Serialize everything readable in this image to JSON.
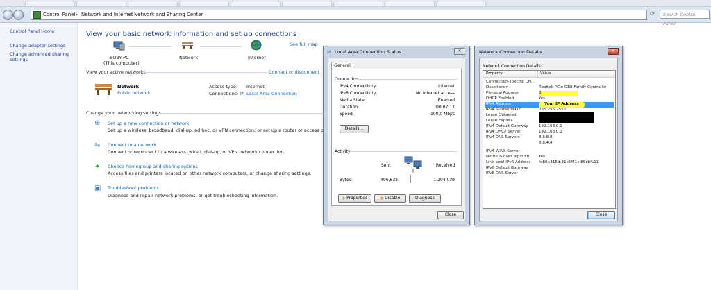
{
  "address_bar": {
    "crumbs": [
      "Control Panel",
      "Network and Internet",
      "Network and Sharing Center"
    ],
    "search_placeholder": "Search Control Panel"
  },
  "left_pane": {
    "items": [
      "Control Panel Home",
      "Change adapter settings",
      "Change advanced sharing",
      "settings"
    ]
  },
  "main": {
    "title": "View your basic network information and set up connections",
    "see_full_map": "See full map",
    "map": {
      "computer": "BOBY-PC",
      "computer_sub": "(This computer)",
      "network": "Network",
      "internet": "Internet"
    },
    "active_networks_heading": "View your active networks",
    "connect_disconnect": "Connect or disconnect",
    "network_name": "Network",
    "network_type": "Public network",
    "access_type_label": "Access type:",
    "access_type_value": "Internet",
    "connections_label": "Connections:",
    "connections_value": "Local Area Connection",
    "change_settings_heading": "Change your networking settings",
    "tasks": [
      {
        "title": "Set up a new connection or network",
        "desc": "Set up a wireless, broadband, dial-up, ad hoc, or VPN connection; or set up a router or access point."
      },
      {
        "title": "Connect to a network",
        "desc": "Connect or reconnect to a wireless, wired, dial-up, or VPN network connection."
      },
      {
        "title": "Choose homegroup and sharing options",
        "desc": "Access files and printers located on other network computers, or change sharing settings."
      },
      {
        "title": "Troubleshoot problems",
        "desc": "Diagnose and repair network problems, or get troubleshooting information."
      }
    ]
  },
  "status_dialog": {
    "title": "Local Area Connection Status",
    "close_glyph": "✕",
    "tab": "General",
    "connection_heading": "Connection",
    "fields": [
      {
        "label": "IPv4 Connectivity:",
        "value": "Internet"
      },
      {
        "label": "IPv6 Connectivity:",
        "value": "No Internet access"
      },
      {
        "label": "Media State:",
        "value": "Enabled"
      },
      {
        "label": "Duration:",
        "value": "00:02:17"
      },
      {
        "label": "Speed:",
        "value": "100.0 Mbps"
      }
    ],
    "details_button": "Details...",
    "activity_heading": "Activity",
    "sent_label": "Sent",
    "received_label": "Received",
    "bytes_label": "Bytes:",
    "bytes_sent": "406,632",
    "bytes_received": "1,294,039",
    "properties_button": "Properties",
    "disable_button": "Disable",
    "diagnose_button": "Diagnose",
    "close_button": "Close"
  },
  "details_dialog": {
    "title": "Network Connection Details",
    "close_glyph": "✕",
    "heading": "Network Connection Details:",
    "col_property": "Property",
    "col_value": "Value",
    "rows": [
      {
        "p": "Connection-specific DN...",
        "v": ""
      },
      {
        "p": "Description",
        "v": "Realtek PCIe GBE Family Controller"
      },
      {
        "p": "Physical Address",
        "v": "3"
      },
      {
        "p": "DHCP Enabled",
        "v": "Yes"
      },
      {
        "p": "IPv4 Address",
        "v": "Your IP Address"
      },
      {
        "p": "IPv4 Subnet Mask",
        "v": "255.255.255.0"
      },
      {
        "p": "Lease Obtained",
        "v": ""
      },
      {
        "p": "Lease Expires",
        "v": ""
      },
      {
        "p": "IPv4 Default Gateway",
        "v": "192.168.0.1"
      },
      {
        "p": "IPv4 DHCP Server",
        "v": "192.168.0.1"
      },
      {
        "p": "IPv4 DNS Servers",
        "v": "8.8.8.8"
      },
      {
        "p": "",
        "v": "8.8.4.4"
      },
      {
        "p": "IPv4 WINS Server",
        "v": ""
      },
      {
        "p": "NetBIOS over Tcpip En...",
        "v": "Yes"
      },
      {
        "p": "Link-local IPv6 Address",
        "v": "fe80::315d:31c5f51c:86cb%11"
      },
      {
        "p": "IPv6 Default Gateway",
        "v": ""
      },
      {
        "p": "IPv6 DNS Server",
        "v": ""
      }
    ],
    "close_button": "Close"
  },
  "colors": {
    "link": "#1566b8",
    "heading": "#1e3e8f",
    "selection": "#3399ff",
    "highlight": "#ffff33"
  }
}
